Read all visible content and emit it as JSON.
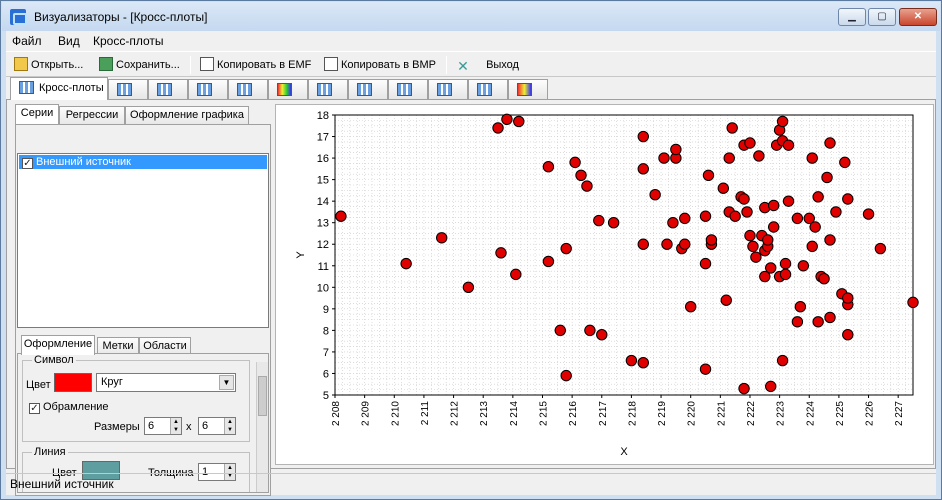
{
  "window": {
    "title": "Визуализаторы - [Кросс-плоты]"
  },
  "menu": [
    "Файл",
    "Вид",
    "Кросс-плоты"
  ],
  "toolbar": {
    "open": "Открыть...",
    "save": "Сохранить...",
    "copy_emf": "Копировать в EMF",
    "copy_bmp": "Копировать в BMP",
    "exit": "Выход"
  },
  "main_tabs": {
    "active_label": "Кросс-плоты"
  },
  "left_tabs": [
    "Серии",
    "Регрессии",
    "Оформление графика"
  ],
  "series": [
    {
      "label": "Внешний источник",
      "checked": true
    }
  ],
  "prop_tabs": [
    "Оформление",
    "Метки",
    "Области"
  ],
  "props": {
    "symbol_group": "Символ",
    "color_label": "Цвет",
    "color": "#ff0000",
    "shape": "Круг",
    "outline_label": "Обрамление",
    "sizes_label": "Размеры",
    "size_w": "6",
    "size_x": "x",
    "size_h": "6",
    "line_group": "Линия",
    "line_color_label": "Цвет",
    "line_color": "#5f9ea0",
    "thickness_label": "Толщина",
    "thickness": "1"
  },
  "status": "Внешний источник",
  "chart_data": {
    "type": "scatter",
    "xlabel": "X",
    "ylabel": "Y",
    "xlim": [
      2208,
      2227.5
    ],
    "ylim": [
      5,
      18
    ],
    "x_ticks": [
      "2 208",
      "2 209",
      "2 210",
      "2 211",
      "2 212",
      "2 213",
      "2 214",
      "2 215",
      "2 216",
      "2 217",
      "2 218",
      "2 219",
      "2 220",
      "2 221",
      "2 222",
      "2 223",
      "2 224",
      "2 225",
      "2 226",
      "2 227"
    ],
    "y_ticks": [
      "5",
      "6",
      "7",
      "8",
      "9",
      "10",
      "11",
      "12",
      "13",
      "14",
      "15",
      "16",
      "17",
      "18"
    ],
    "grid": true,
    "marker_color": "#e00000",
    "points": [
      [
        2208.2,
        13.3
      ],
      [
        2210.4,
        11.1
      ],
      [
        2211.6,
        12.3
      ],
      [
        2212.5,
        10.0
      ],
      [
        2213.5,
        17.4
      ],
      [
        2213.8,
        17.8
      ],
      [
        2214.2,
        17.7
      ],
      [
        2213.6,
        11.6
      ],
      [
        2214.1,
        10.6
      ],
      [
        2215.2,
        15.6
      ],
      [
        2215.2,
        11.2
      ],
      [
        2215.6,
        8.0
      ],
      [
        2215.8,
        5.9
      ],
      [
        2215.8,
        11.8
      ],
      [
        2216.1,
        15.8
      ],
      [
        2216.3,
        15.2
      ],
      [
        2216.5,
        14.7
      ],
      [
        2216.6,
        8.0
      ],
      [
        2216.9,
        13.1
      ],
      [
        2217.0,
        7.8
      ],
      [
        2217.4,
        13.0
      ],
      [
        2218.0,
        6.6
      ],
      [
        2218.4,
        6.5
      ],
      [
        2218.4,
        17.0
      ],
      [
        2218.4,
        15.5
      ],
      [
        2218.4,
        12.0
      ],
      [
        2218.8,
        14.3
      ],
      [
        2219.1,
        16.0
      ],
      [
        2219.2,
        12.0
      ],
      [
        2219.4,
        13.0
      ],
      [
        2219.5,
        16.0
      ],
      [
        2219.5,
        16.4
      ],
      [
        2219.7,
        11.8
      ],
      [
        2219.8,
        12.0
      ],
      [
        2219.8,
        13.2
      ],
      [
        2220.0,
        9.1
      ],
      [
        2220.5,
        11.1
      ],
      [
        2220.5,
        13.3
      ],
      [
        2220.5,
        6.2
      ],
      [
        2220.6,
        15.2
      ],
      [
        2220.7,
        12.0
      ],
      [
        2220.7,
        12.2
      ],
      [
        2221.1,
        14.6
      ],
      [
        2221.2,
        9.4
      ],
      [
        2221.3,
        13.5
      ],
      [
        2221.3,
        16.0
      ],
      [
        2221.4,
        17.4
      ],
      [
        2221.5,
        13.3
      ],
      [
        2221.7,
        14.2
      ],
      [
        2221.8,
        16.6
      ],
      [
        2221.8,
        14.1
      ],
      [
        2221.8,
        5.3
      ],
      [
        2221.9,
        13.5
      ],
      [
        2222.0,
        16.7
      ],
      [
        2222.0,
        12.4
      ],
      [
        2222.1,
        11.9
      ],
      [
        2222.2,
        11.4
      ],
      [
        2222.3,
        16.1
      ],
      [
        2222.4,
        12.4
      ],
      [
        2222.5,
        13.7
      ],
      [
        2222.5,
        11.7
      ],
      [
        2222.5,
        10.5
      ],
      [
        2222.6,
        11.9
      ],
      [
        2222.6,
        12.2
      ],
      [
        2222.7,
        10.9
      ],
      [
        2222.7,
        5.4
      ],
      [
        2222.8,
        12.8
      ],
      [
        2222.8,
        13.8
      ],
      [
        2222.9,
        16.6
      ],
      [
        2223.0,
        17.3
      ],
      [
        2223.0,
        10.5
      ],
      [
        2223.1,
        17.7
      ],
      [
        2223.1,
        16.8
      ],
      [
        2223.1,
        6.6
      ],
      [
        2223.2,
        10.6
      ],
      [
        2223.2,
        11.1
      ],
      [
        2223.3,
        16.6
      ],
      [
        2223.3,
        14.0
      ],
      [
        2223.6,
        13.2
      ],
      [
        2223.6,
        8.4
      ],
      [
        2223.7,
        9.1
      ],
      [
        2223.8,
        11.0
      ],
      [
        2224.0,
        13.2
      ],
      [
        2224.1,
        16.0
      ],
      [
        2224.1,
        11.9
      ],
      [
        2224.2,
        12.8
      ],
      [
        2224.3,
        8.4
      ],
      [
        2224.3,
        14.2
      ],
      [
        2224.4,
        10.5
      ],
      [
        2224.5,
        10.4
      ],
      [
        2224.6,
        15.1
      ],
      [
        2224.7,
        8.6
      ],
      [
        2224.7,
        12.2
      ],
      [
        2224.7,
        16.7
      ],
      [
        2224.9,
        13.5
      ],
      [
        2225.1,
        9.7
      ],
      [
        2225.2,
        15.8
      ],
      [
        2225.3,
        14.1
      ],
      [
        2225.3,
        9.2
      ],
      [
        2225.3,
        9.5
      ],
      [
        2225.3,
        7.8
      ],
      [
        2226.0,
        13.4
      ],
      [
        2226.4,
        11.8
      ],
      [
        2229.0,
        9.3
      ]
    ]
  }
}
